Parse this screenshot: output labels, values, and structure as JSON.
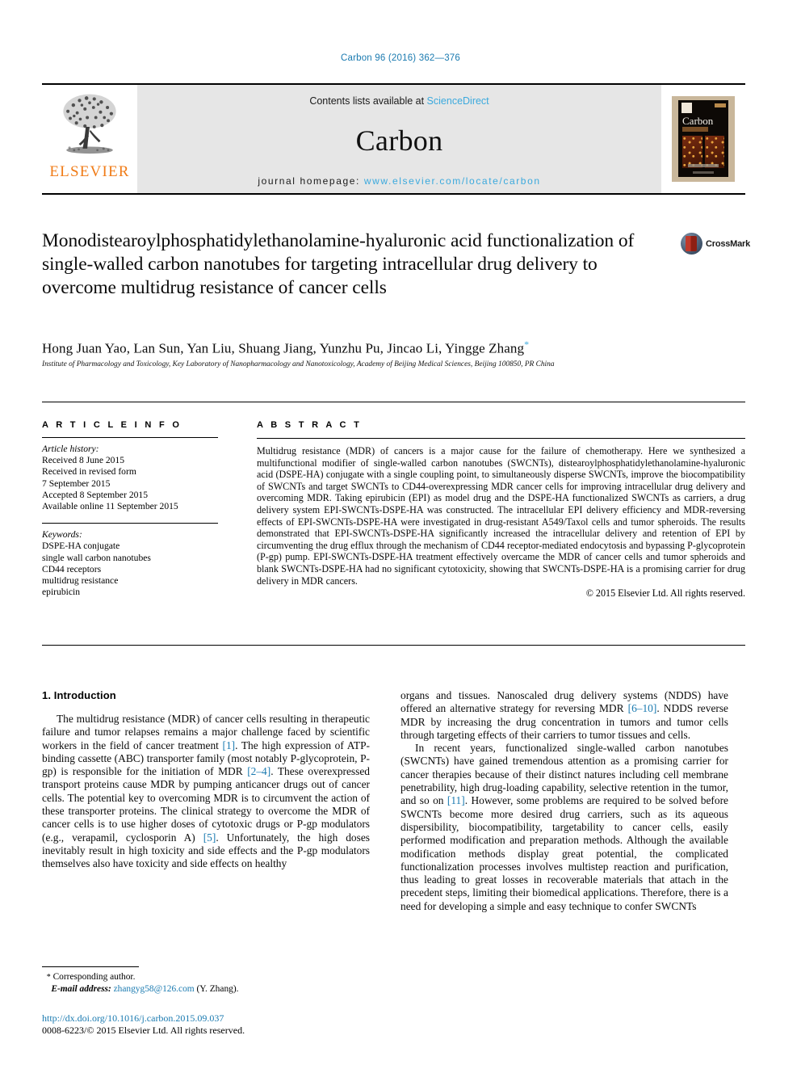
{
  "running_head": "Carbon 96 (2016) 362—376",
  "masthead": {
    "publisher_name": "ELSEVIER",
    "contents_prefix": "Contents lists available at ",
    "contents_link": "ScienceDirect",
    "journal_name": "Carbon",
    "homepage_prefix": "journal homepage: ",
    "homepage_url": "www.elsevier.com/locate/carbon",
    "cover_title": "Carbon"
  },
  "article": {
    "title": "Monodistearoylphosphatidylethanolamine-hyaluronic acid functionalization of single-walled carbon nanotubes for targeting intracellular drug delivery to overcome multidrug resistance of cancer cells",
    "crossmark_label": "CrossMark",
    "authors": "Hong Juan Yao, Lan Sun, Yan Liu, Shuang Jiang, Yunzhu Pu, Jincao Li, Yingge Zhang",
    "corresponding_marker": "*",
    "affiliation": "Institute of Pharmacology and Toxicology, Key Laboratory of Nanopharmacology and Nanotoxicology, Academy of Beijing Medical Sciences, Beijing 100850, PR China"
  },
  "article_info": {
    "heading": "A R T I C L E   I N F O",
    "history_heading": "Article history:",
    "history": [
      "Received 8 June 2015",
      "Received in revised form",
      "7 September 2015",
      "Accepted 8 September 2015",
      "Available online 11 September 2015"
    ],
    "keywords_heading": "Keywords:",
    "keywords": [
      "DSPE-HA conjugate",
      "single wall carbon nanotubes",
      "CD44 receptors",
      "multidrug resistance",
      "epirubicin"
    ]
  },
  "abstract": {
    "heading": "A B S T R A C T",
    "text": "Multidrug resistance (MDR) of cancers is a major cause for the failure of chemotherapy. Here we synthesized a multifunctional modifier of single-walled carbon nanotubes (SWCNTs), distearoylphosphatidylethanolamine-hyaluronic acid (DSPE-HA) conjugate with a single coupling point, to simultaneously disperse SWCNTs, improve the biocompatibility of SWCNTs and target SWCNTs to CD44-overexpressing MDR cancer cells for improving intracellular drug delivery and overcoming MDR. Taking epirubicin (EPI) as model drug and the DSPE-HA functionalized SWCNTs as carriers, a drug delivery system EPI-SWCNTs-DSPE-HA was constructed. The intracellular EPI delivery efficiency and MDR-reversing effects of EPI-SWCNTs-DSPE-HA were investigated in drug-resistant A549/Taxol cells and tumor spheroids. The results demonstrated that EPI-SWCNTs-DSPE-HA significantly increased the intracellular delivery and retention of EPI by circumventing the drug efflux through the mechanism of CD44 receptor-mediated endocytosis and bypassing P-glycoprotein (P-gp) pump. EPI-SWCNTs-DSPE-HA treatment effectively overcame the MDR of cancer cells and tumor spheroids and blank SWCNTs-DSPE-HA had no significant cytotoxicity, showing that SWCNTs-DSPE-HA is a promising carrier for drug delivery in MDR cancers.",
    "copyright": "© 2015 Elsevier Ltd. All rights reserved."
  },
  "body": {
    "section_heading": "1.  Introduction",
    "left_paragraphs": [
      "The multidrug resistance (MDR) of cancer cells resulting in therapeutic failure and tumor relapses remains a major challenge faced by scientific workers in the field of cancer treatment [1]. The high expression of ATP-binding cassette (ABC) transporter family (most notably P-glycoprotein, P-gp) is responsible for the initiation of MDR [2–4]. These overexpressed transport proteins cause MDR by pumping anticancer drugs out of cancer cells. The potential key to overcoming MDR is to circumvent the action of these transporter proteins. The clinical strategy to overcome the MDR of cancer cells is to use higher doses of cytotoxic drugs or P-gp modulators (e.g., verapamil, cyclosporin A) [5]. Unfortunately, the high doses inevitably result in high toxicity and side effects and the P-gp modulators themselves also have toxicity and side effects on healthy"
    ],
    "right_paragraphs": [
      "organs and tissues. Nanoscaled drug delivery systems (NDDS) have offered an alternative strategy for reversing MDR [6–10]. NDDS reverse MDR by increasing the drug concentration in tumors and tumor cells through targeting effects of their carriers to tumor tissues and cells.",
      "In recent years, functionalized single-walled carbon nanotubes (SWCNTs) have gained tremendous attention as a promising carrier for cancer therapies because of their distinct natures including cell membrane penetrability, high drug-loading capability, selective retention in the tumor, and so on [11]. However, some problems are required to be solved before SWCNTs become more desired drug carriers, such as its aqueous dispersibility, biocompatibility, targetability to cancer cells, easily performed modification and preparation methods. Although the available modification methods display great potential, the complicated functionalization processes involves multistep reaction and purification, thus leading to great losses in recoverable materials that attach in the precedent steps, limiting their biomedical applications. Therefore, there is a need for developing a simple and easy technique to confer SWCNTs"
    ]
  },
  "footnote": {
    "star": "*",
    "corresponding": "Corresponding author.",
    "email_label": "E-mail address:",
    "email": "zhangyg58@126.com",
    "email_suffix": "(Y. Zhang)."
  },
  "footer": {
    "doi": "http://dx.doi.org/10.1016/j.carbon.2015.09.037",
    "issn_line": "0008-6223/© 2015 Elsevier Ltd. All rights reserved."
  },
  "colors": {
    "link": "#1a7ab0",
    "masthead_link": "#3ba9dd",
    "elsevier_orange": "#f07c18",
    "masthead_bg": "#e6e6e6"
  }
}
